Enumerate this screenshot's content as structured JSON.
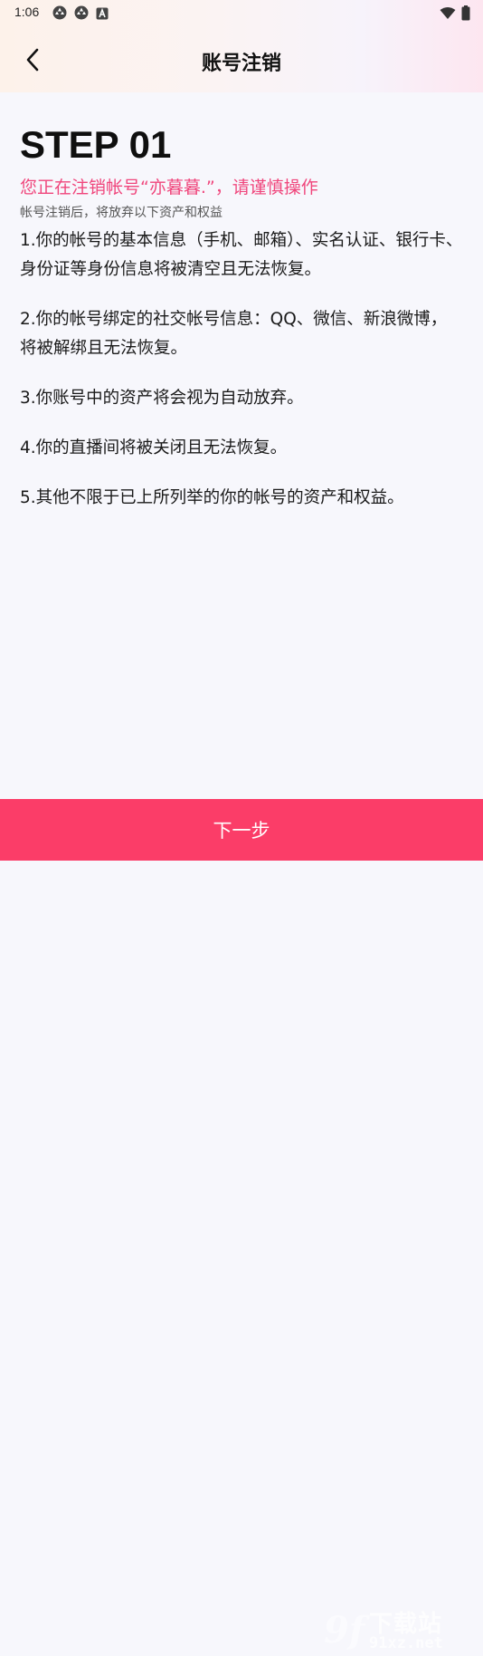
{
  "status_bar": {
    "time": "1:06",
    "left_icons": [
      "app-notification-icon",
      "app-notification-icon",
      "a-notification-icon"
    ],
    "right_icons": [
      "wifi-icon",
      "battery-icon"
    ]
  },
  "header": {
    "title": "账号注销",
    "back_icon": "chevron-left-icon"
  },
  "main": {
    "step_title": "STEP 01",
    "warning": "您正在注销帐号“亦暮暮.”，请谨慎操作",
    "subtitle": "帐号注销后，将放弃以下资产和权益",
    "items": [
      "1.你的帐号的基本信息（手机、邮箱）、实名认证、银行卡、身份证等身份信息将被清空且无法恢复。",
      "2.你的帐号绑定的社交帐号信息：QQ、微信、新浪微博，将被解绑且无法恢复。",
      "3.你账号中的资产将会视为自动放弃。",
      "4.你的直播间将被关闭且无法恢复。",
      "5.其他不限于已上所列举的你的帐号的资产和权益。"
    ]
  },
  "footer": {
    "next_label": "下一步"
  },
  "watermark": {
    "logo": "9f",
    "top_text": "下载站",
    "bottom_text": "91xz.net"
  },
  "colors": {
    "accent": "#fb3d68",
    "warning_text": "#f0467c",
    "background": "#f7f7fc"
  }
}
